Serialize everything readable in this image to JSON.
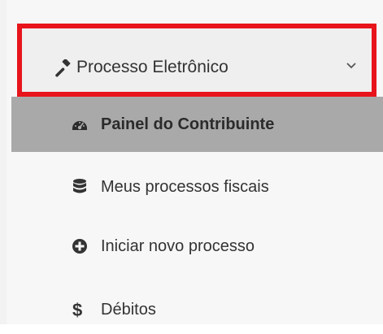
{
  "menu": {
    "header": {
      "label": "Processo Eletrônico",
      "icon": "gavel-icon",
      "chevron_icon": "chevron-down-icon"
    },
    "items": [
      {
        "label": "Painel do Contribuinte",
        "icon": "dashboard-icon",
        "active": true
      },
      {
        "label": "Meus processos fiscais",
        "icon": "database-icon",
        "active": false
      },
      {
        "label": "Iniciar novo processo",
        "icon": "plus-circle-icon",
        "active": false
      },
      {
        "label": "Débitos",
        "icon": "dollar-icon",
        "icon_glyph": "$",
        "active": false
      }
    ]
  },
  "colors": {
    "highlight_border": "#e8141b",
    "active_bg": "#a9a9a9",
    "text": "#333333"
  }
}
